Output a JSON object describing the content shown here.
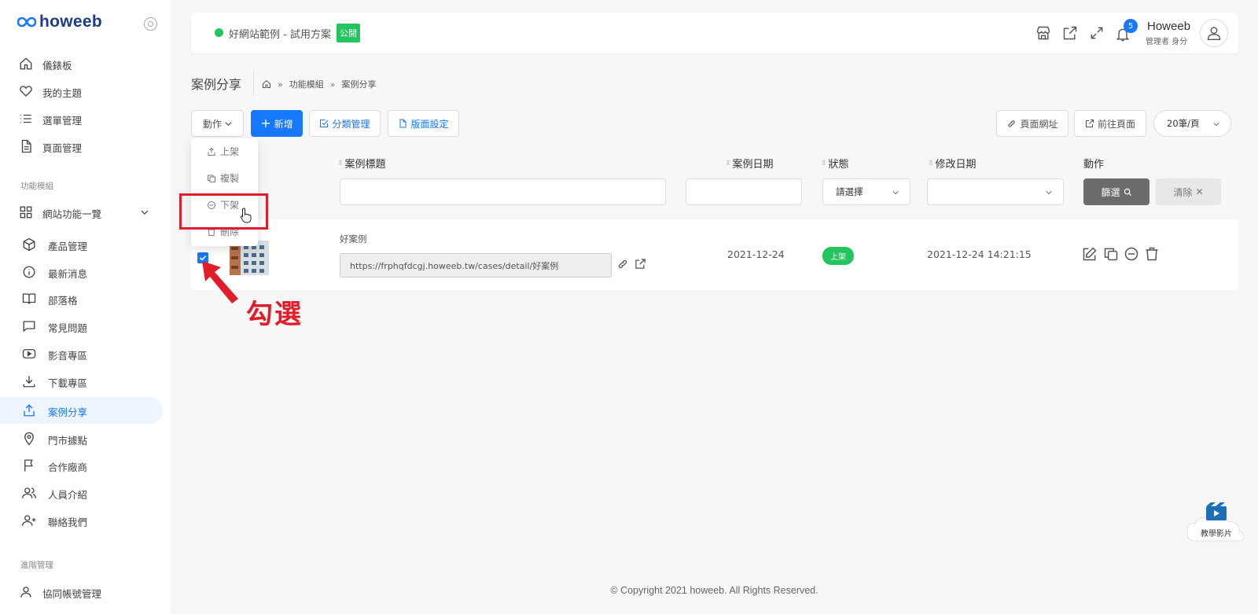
{
  "brand": {
    "logo_text": "howeeb"
  },
  "sidebar": {
    "items": [
      {
        "label": "儀錶板"
      },
      {
        "label": "我的主題"
      },
      {
        "label": "選單管理"
      },
      {
        "label": "頁面管理"
      }
    ],
    "section_modules": "功能模組",
    "module_group": "網站功能一覽",
    "sub_items": [
      {
        "label": "產品管理"
      },
      {
        "label": "最新消息"
      },
      {
        "label": "部落格"
      },
      {
        "label": "常見問題"
      },
      {
        "label": "影音專區"
      },
      {
        "label": "下載專區"
      },
      {
        "label": "案例分享"
      },
      {
        "label": "門市據點"
      },
      {
        "label": "合作廠商"
      },
      {
        "label": "人員介紹"
      },
      {
        "label": "聯絡我們"
      }
    ],
    "section_advanced": "進階管理",
    "advanced_items": [
      {
        "label": "協同帳號管理"
      }
    ]
  },
  "topbar": {
    "site_name": "好網站範例 - 試用方案",
    "public_badge": "公開",
    "notification_count": "5",
    "user_name": "Howeeb",
    "user_role": "管理者 身分"
  },
  "page": {
    "title": "案例分享",
    "breadcrumb": [
      "功能模組",
      "案例分享"
    ]
  },
  "toolbar": {
    "action_label": "動作",
    "add_label": "新增",
    "category_label": "分類管理",
    "layout_label": "版面設定",
    "page_url_label": "頁面網址",
    "goto_page_label": "前往頁面",
    "per_page_value": "20筆/頁"
  },
  "dropdown": {
    "items": [
      "上架",
      "複製",
      "下架",
      "刪除"
    ]
  },
  "table": {
    "headers": {
      "title": "案例標題",
      "date": "案例日期",
      "status": "狀態",
      "modified": "修改日期",
      "actions": "動作"
    },
    "status_placeholder": "請選擇",
    "filter_label": "篩選",
    "clear_label": "清除",
    "rows": [
      {
        "title": "好案例",
        "url": "https://frphqfdcgj.howeeb.tw/cases/detail/好案例",
        "date": "2021-12-24",
        "status": "上架",
        "modified": "2021-12-24 14:21:15"
      }
    ]
  },
  "annotation": {
    "text": "勾選"
  },
  "footer": {
    "copyright": "© Copyright 2021 howeeb. All Rights Reserved."
  },
  "tutorial": {
    "label": "教學影片"
  },
  "colors": {
    "primary": "#1677ff",
    "success": "#22c55e",
    "annotation_red": "#e11d2a",
    "brand_navy": "#1e3a8a"
  }
}
